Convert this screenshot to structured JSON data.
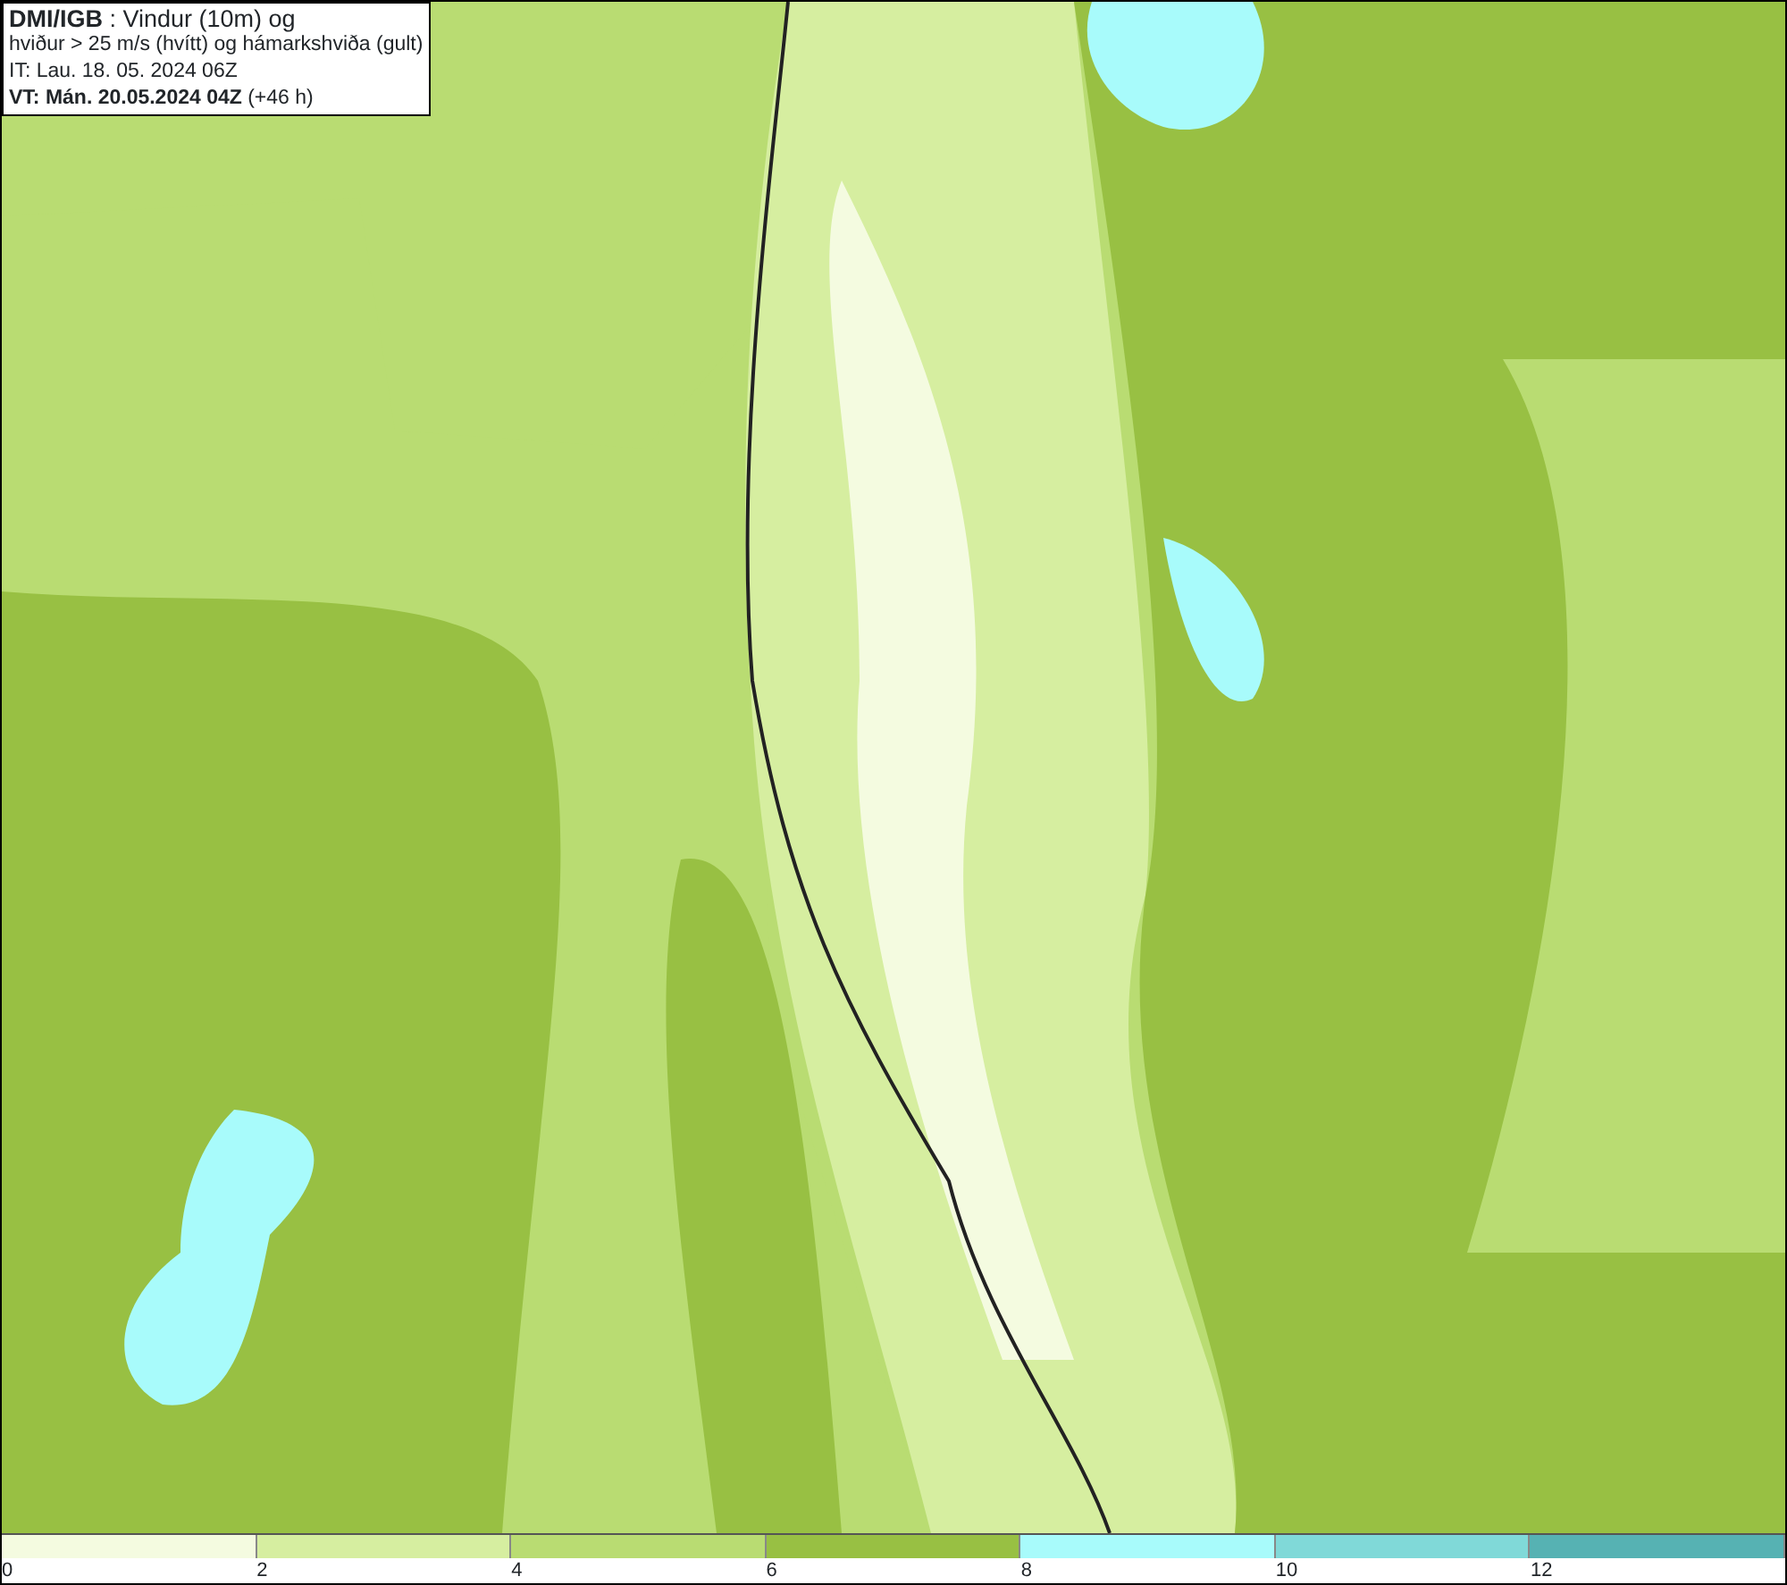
{
  "caption": {
    "lines": [
      "**DMI/IGB** : Vindur (10m) og",
      "hviður > 25 m/s (hvítt) og hámarkshviða (gult)",
      "IT: Lau. 18. 05. 2024 06Z",
      "**VT: Mán. 20.05.2024 04Z** (+46 h)"
    ]
  },
  "legend": [
    {
      "label": "0",
      "color": "#f4fbe0"
    },
    {
      "label": "2",
      "color": "#d6eea0"
    },
    {
      "label": "4",
      "color": "#b9dc72"
    },
    {
      "label": "6",
      "color": "#98c043"
    },
    {
      "label": "8",
      "color": "#a8fbfb"
    },
    {
      "label": "10",
      "color": "#80d9d8"
    },
    {
      "label": "12",
      "color": "#56b2b3"
    }
  ]
}
